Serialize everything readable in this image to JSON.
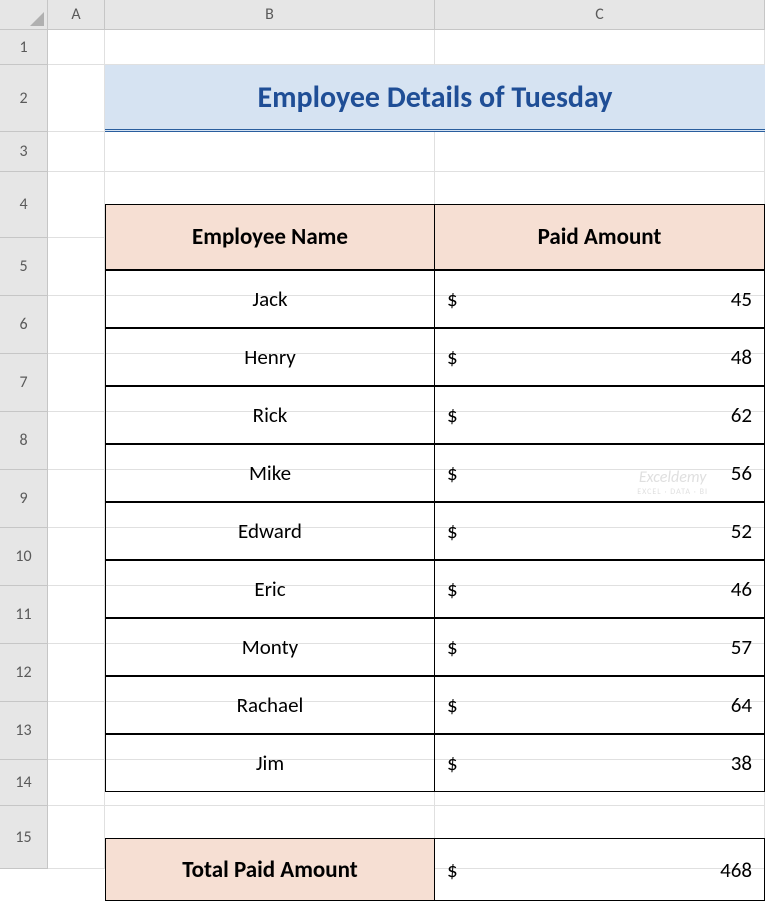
{
  "columns": [
    "A",
    "B",
    "C"
  ],
  "rows": [
    "1",
    "2",
    "3",
    "4",
    "5",
    "6",
    "7",
    "8",
    "9",
    "10",
    "11",
    "12",
    "13",
    "14",
    "15"
  ],
  "title": "Employee Details of Tuesday",
  "headers": {
    "name": "Employee Name",
    "amount": "Paid Amount"
  },
  "employees": [
    {
      "name": "Jack",
      "amount": "45"
    },
    {
      "name": "Henry",
      "amount": "48"
    },
    {
      "name": "Rick",
      "amount": "62"
    },
    {
      "name": "Mike",
      "amount": "56"
    },
    {
      "name": "Edward",
      "amount": "52"
    },
    {
      "name": "Eric",
      "amount": "46"
    },
    {
      "name": "Monty",
      "amount": "57"
    },
    {
      "name": "Rachael",
      "amount": "64"
    },
    {
      "name": "Jim",
      "amount": "38"
    }
  ],
  "currency": "$",
  "total": {
    "label": "Total Paid Amount",
    "value": "468"
  },
  "watermark": {
    "main": "Exceldemy",
    "sub": "EXCEL · DATA · BI"
  },
  "chart_data": {
    "type": "table",
    "title": "Employee Details of Tuesday",
    "columns": [
      "Employee Name",
      "Paid Amount"
    ],
    "rows": [
      [
        "Jack",
        45
      ],
      [
        "Henry",
        48
      ],
      [
        "Rick",
        62
      ],
      [
        "Mike",
        56
      ],
      [
        "Edward",
        52
      ],
      [
        "Eric",
        46
      ],
      [
        "Monty",
        57
      ],
      [
        "Rachael",
        64
      ],
      [
        "Jim",
        38
      ]
    ],
    "total": 468
  }
}
